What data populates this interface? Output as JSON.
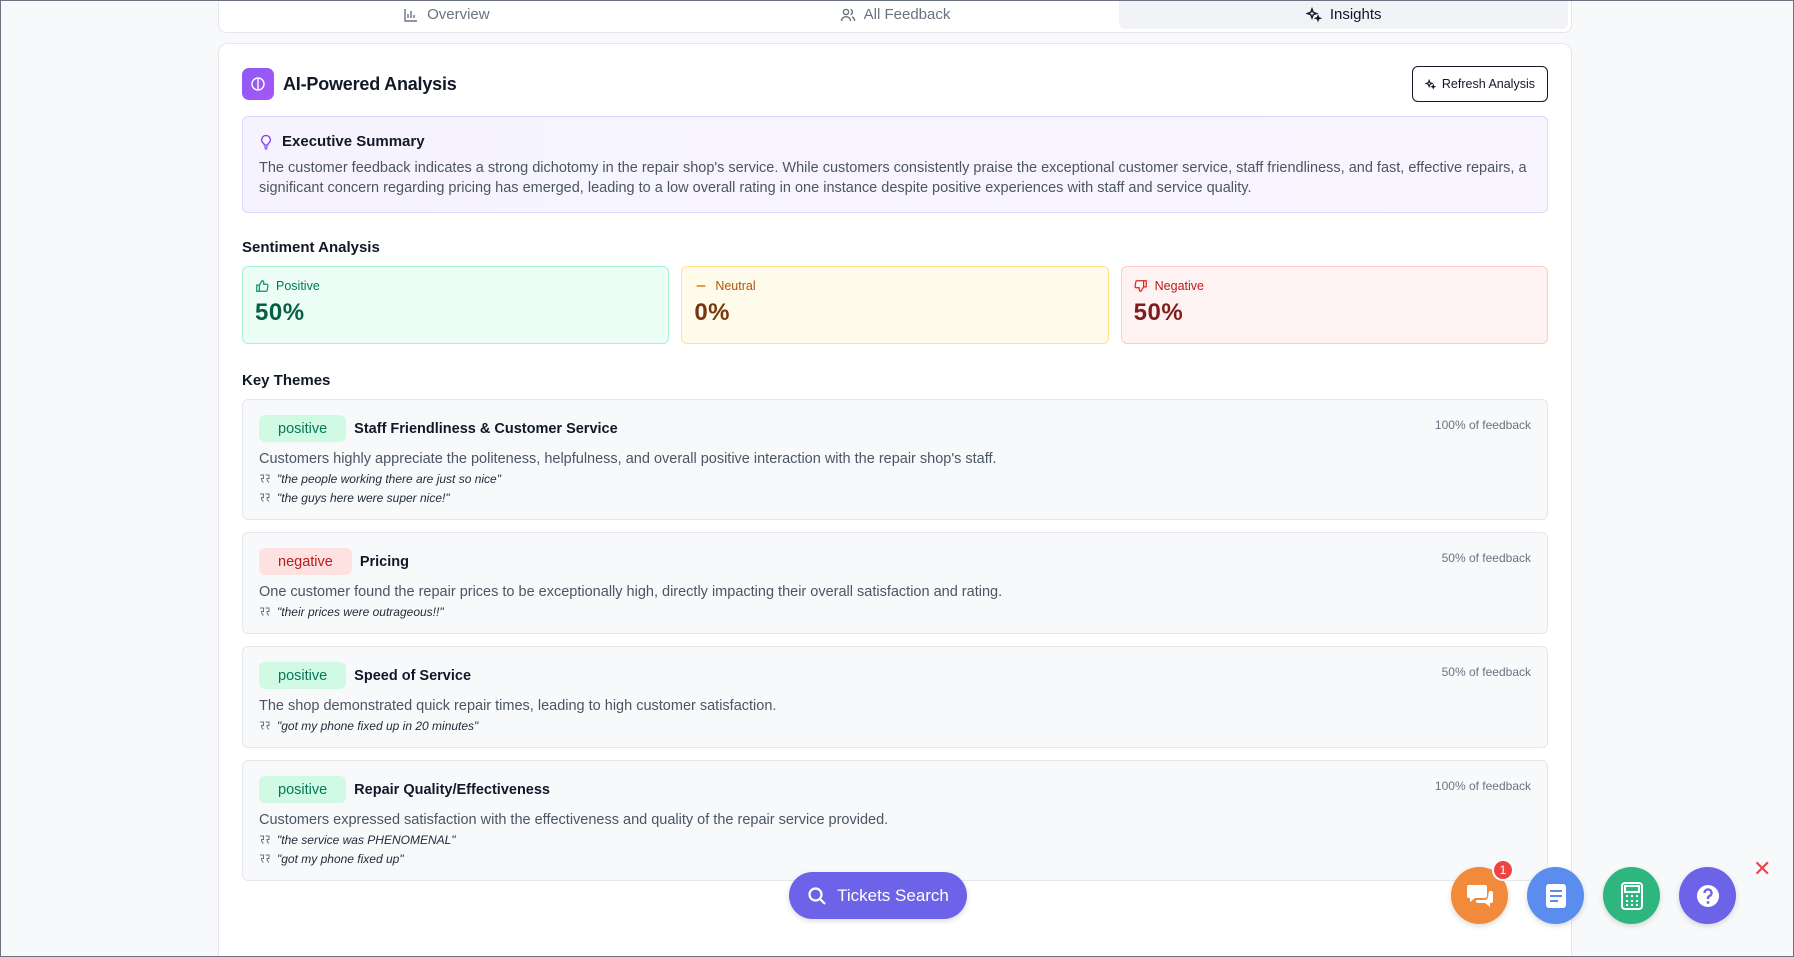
{
  "tabs": [
    {
      "label": "Overview",
      "icon": "bar-chart-icon"
    },
    {
      "label": "All Feedback",
      "icon": "users-icon"
    },
    {
      "label": "Insights",
      "icon": "sparkles-icon",
      "active": true
    }
  ],
  "analysis": {
    "title": "AI-Powered Analysis",
    "refresh_label": "Refresh Analysis"
  },
  "executive_summary": {
    "title": "Executive Summary",
    "text": "The customer feedback indicates a strong dichotomy in the repair shop's service. While customers consistently praise the exceptional customer service, staff friendliness, and fast, effective repairs, a significant concern regarding pricing has emerged, leading to a low overall rating in one instance despite positive experiences with staff and service quality."
  },
  "sentiment": {
    "title": "Sentiment Analysis",
    "positive": {
      "label": "Positive",
      "value": "50%"
    },
    "neutral": {
      "label": "Neutral",
      "value": "0%"
    },
    "negative": {
      "label": "Negative",
      "value": "50%"
    }
  },
  "themes_title": "Key Themes",
  "themes": [
    {
      "sentiment": "positive",
      "name": "Staff Friendliness & Customer Service",
      "pct": "100% of feedback",
      "desc": "Customers highly appreciate the politeness, helpfulness, and overall positive interaction with the repair shop's staff.",
      "quotes": [
        "\"the people working there are just so nice\"",
        "\"the guys here were super nice!\""
      ]
    },
    {
      "sentiment": "negative",
      "name": "Pricing",
      "pct": "50% of feedback",
      "desc": "One customer found the repair prices to be exceptionally high, directly impacting their overall satisfaction and rating.",
      "quotes": [
        "\"their prices were outrageous!!\""
      ]
    },
    {
      "sentiment": "positive",
      "name": "Speed of Service",
      "pct": "50% of feedback",
      "desc": "The shop demonstrated quick repair times, leading to high customer satisfaction.",
      "quotes": [
        "\"got my phone fixed up in 20 minutes\""
      ]
    },
    {
      "sentiment": "positive",
      "name": "Repair Quality/Effectiveness",
      "pct": "100% of feedback",
      "desc": "Customers expressed satisfaction with the effectiveness and quality of the repair service provided.",
      "quotes": [
        "\"the service was PHENOMENAL\"",
        "\"got my phone fixed up\""
      ]
    }
  ],
  "floating": {
    "tickets_search": "Tickets Search",
    "chat_badge": "1",
    "close": "✕"
  }
}
